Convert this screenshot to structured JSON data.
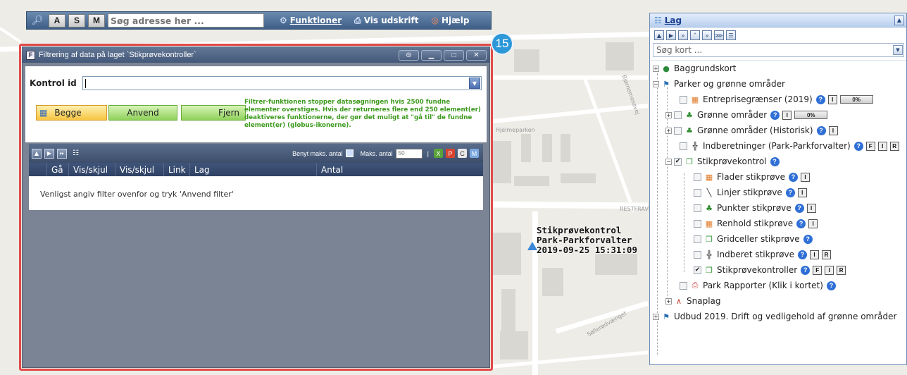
{
  "toolbar": {
    "key_a": "A",
    "key_s": "S",
    "key_m": "M",
    "address_placeholder": "Søg adresse her ...",
    "functions": "Funktioner",
    "print": "Vis udskrift",
    "help": "Hjælp"
  },
  "map": {
    "street_1": "Hjelmeparken",
    "street_2": "Bjørnemosevej",
    "street_3": "RESTFRAVE",
    "street_4": "Søllerødvænget",
    "marker": {
      "line1": "Stikprøvekontrol",
      "line2": "Park-Parkforvalter",
      "line3": "2019-09-25 15:31:09"
    }
  },
  "badge": "15",
  "dialog": {
    "title": "Filtrering af data på laget `Stikprøvekontroller`",
    "kontrol_label": "Kontrol id",
    "kontrol_value": "",
    "btn_begge": "Begge",
    "btn_anvend": "Anvend",
    "btn_fjern": "Fjern",
    "note": "Filtrer-funktionen stopper datasøgningen hvis 2500 fundne elementer overstiges. Hvis der returneres flere end 250 element(er) deaktiveres funktionerne, der gør det muligt at \"gå til\" de fundne element(er) (globus-ikonerne).",
    "max_label": "Benyt maks. antal",
    "max_count_label": "Maks. antal",
    "max_count_value": "50",
    "columns": [
      "Gå",
      "Vis/skjul",
      "Vis/skjul",
      "Link",
      "Lag",
      "Antal"
    ],
    "empty_message": "Venligst angiv filter ovenfor og tryk 'Anvend filter'"
  },
  "layers": {
    "title": "Lag",
    "search_placeholder": "Søg kort ...",
    "items": [
      {
        "label": "Baggrundskort"
      },
      {
        "label": "Parker og grønne områder"
      },
      {
        "label": "Entreprisegrænser (2019)",
        "pct": "0%"
      },
      {
        "label": "Grønne områder",
        "pct": "0%"
      },
      {
        "label": "Grønne områder (Historisk)"
      },
      {
        "label": "Indberetninger (Park-Parkforvalter)"
      },
      {
        "label": "Stikprøvekontrol"
      },
      {
        "label": "Flader stikprøve"
      },
      {
        "label": "Linjer stikprøve"
      },
      {
        "label": "Punkter stikprøve"
      },
      {
        "label": "Renhold stikprøve"
      },
      {
        "label": "Gridceller stikprøve"
      },
      {
        "label": "Indberet stikprøve"
      },
      {
        "label": "Stikprøvekontroller"
      },
      {
        "label": "Park Rapporter (Klik i kortet)"
      },
      {
        "label": "Snaplag"
      },
      {
        "label": "Udbud 2019. Drift og vedligehold af grønne områder"
      }
    ],
    "badge_i": "I",
    "badge_f": "F",
    "badge_r": "R"
  },
  "colors": {
    "highlight": "#e24a4a",
    "badge": "#2d97d8",
    "note_text": "#3d9a1e",
    "help_icon": "#2f6fd6"
  }
}
